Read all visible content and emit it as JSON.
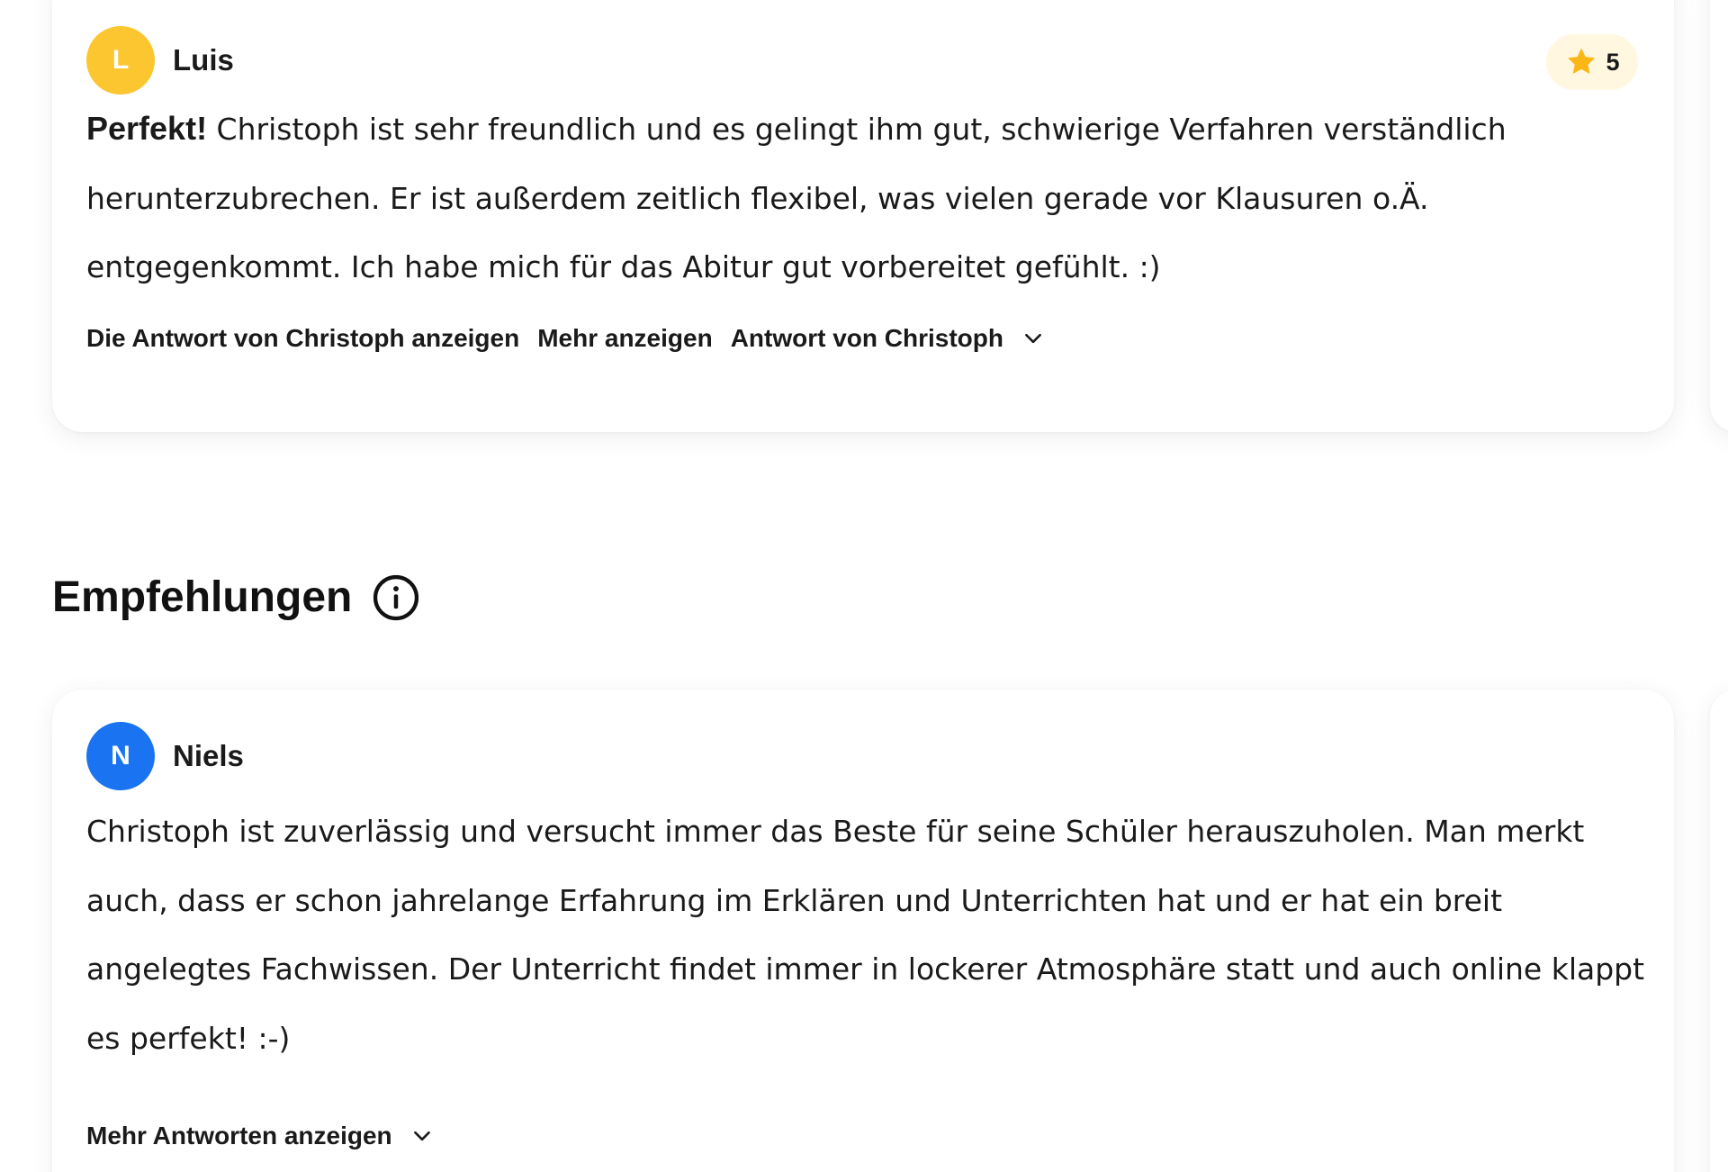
{
  "reviews_top": {
    "reviewer_initial": "L",
    "reviewer_name": "Luis",
    "avatar_color": "#fcc630",
    "rating": "5",
    "text_bold": "Perfekt!",
    "text": " Christoph ist sehr freundlich und es gelingt ihm gut, schwierige Verfahren verständlich herunterzubrechen. Er ist außerdem zeitlich flexibel, was vielen gerade vor Klausuren o.Ä. entgegenkommt. Ich habe mich für das Abitur gut vorbereitet gefühlt. :)",
    "actions": {
      "show_reply": "Die Antwort von Christoph anzeigen",
      "show_more": "Mehr anzeigen",
      "reply_from": "Antwort von Christoph"
    }
  },
  "recommendations": {
    "title": "Empfehlungen",
    "info_icon": "info-icon",
    "review": {
      "reviewer_initial": "N",
      "reviewer_name": "Niels",
      "avatar_color": "#1a73f0",
      "text": "Christoph ist zuverlässig und versucht immer das Beste für seine Schüler herauszuholen. Man merkt auch, dass er schon jahrelange Erfahrung im Erklären und Unterrichten hat und er hat ein breit angelegtes Fachwissen. Der Unterricht findet immer in lockerer Atmosphäre statt und auch online klappt es perfekt! :-)",
      "show_more_replies": "Mehr Antworten anzeigen"
    }
  },
  "colors": {
    "star": "#fbb716",
    "rating_pill_bg": "#fff7e0",
    "text": "#1a1a1a"
  }
}
